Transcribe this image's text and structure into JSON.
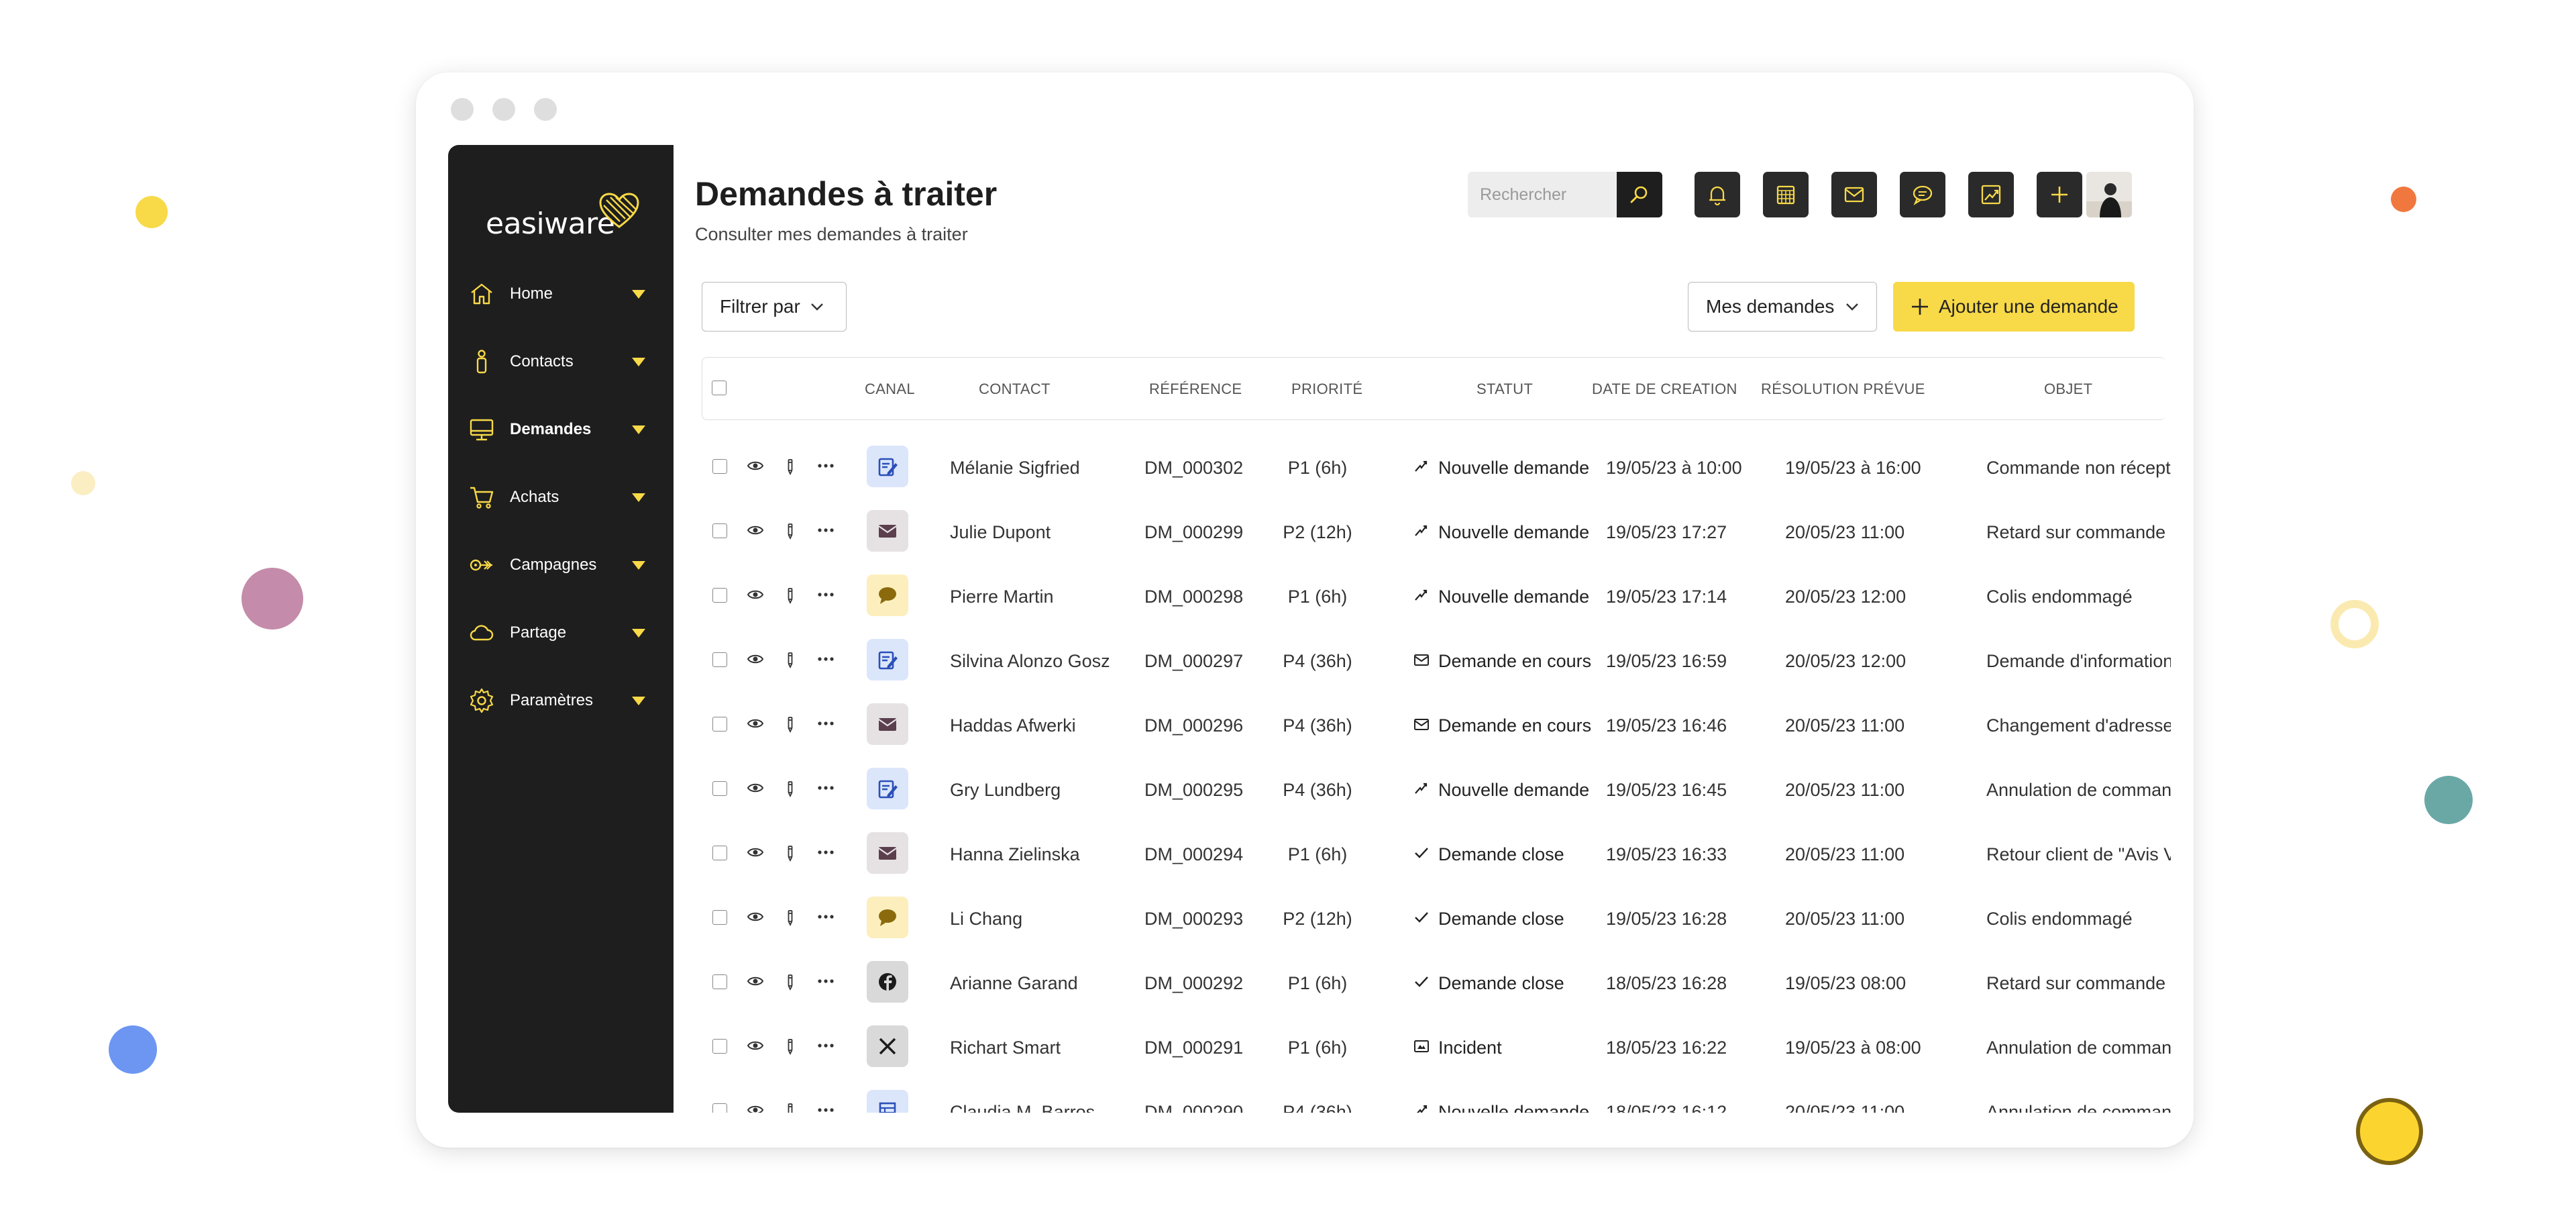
{
  "colors": {
    "accent": "#f8d947",
    "sidebar_bg": "#1e1e1e",
    "toolbar_btn": "#2a2a2a"
  },
  "logo": {
    "text": "easiware"
  },
  "sidebar": {
    "items": [
      {
        "label": "Home",
        "icon": "home-icon"
      },
      {
        "label": "Contacts",
        "icon": "contact-icon"
      },
      {
        "label": "Demandes",
        "icon": "monitor-icon",
        "active": true
      },
      {
        "label": "Achats",
        "icon": "cart-icon"
      },
      {
        "label": "Campagnes",
        "icon": "campaign-icon"
      },
      {
        "label": "Partage",
        "icon": "cloud-icon"
      },
      {
        "label": "Paramètres",
        "icon": "gear-icon"
      }
    ]
  },
  "header": {
    "title": "Demandes à traiter",
    "subtitle": "Consulter mes demandes à traiter",
    "search_placeholder": "Rechercher",
    "toolbar": [
      "bell-icon",
      "calendar-icon",
      "mail-icon",
      "chat-icon",
      "chart-icon",
      "plus-icon"
    ]
  },
  "actions": {
    "filter_label": "Filtrer par",
    "mine_label": "Mes demandes",
    "add_label": "Ajouter une demande"
  },
  "table": {
    "columns": [
      "CANAL",
      "CONTACT",
      "RÉFÉRENCE",
      "PRIORITÉ",
      "STATUT",
      "DATE DE CREATION",
      "RÉSOLUTION PRÉVUE",
      "OBJET"
    ],
    "rows": [
      {
        "channel": "form",
        "contact": "Mélanie Sigfried",
        "ref": "DM_000302",
        "priority": "P1 (6h)",
        "status_icon": "new",
        "status": "Nouvelle demande",
        "created": "19/05/23 à 10:00",
        "resolution": "19/05/23 à 16:00",
        "object": "Commande non réceptionnée"
      },
      {
        "channel": "mail",
        "contact": "Julie Dupont",
        "ref": "DM_000299",
        "priority": "P2 (12h)",
        "status_icon": "new",
        "status": "Nouvelle demande",
        "created": "19/05/23 17:27",
        "resolution": "20/05/23 11:00",
        "object": "Retard sur commande"
      },
      {
        "channel": "chat",
        "contact": "Pierre Martin",
        "ref": "DM_000298",
        "priority": "P1 (6h)",
        "status_icon": "new",
        "status": "Nouvelle demande",
        "created": "19/05/23 17:14",
        "resolution": "20/05/23 12:00",
        "object": "Colis endommagé"
      },
      {
        "channel": "form",
        "contact": "Silvina Alonzo Gosz",
        "ref": "DM_000297",
        "priority": "P4 (36h)",
        "status_icon": "progress",
        "status": "Demande en cours",
        "created": "19/05/23 16:59",
        "resolution": "20/05/23 12:00",
        "object": "Demande d'informations"
      },
      {
        "channel": "mail",
        "contact": "Haddas Afwerki",
        "ref": "DM_000296",
        "priority": "P4 (36h)",
        "status_icon": "progress",
        "status": "Demande en cours",
        "created": "19/05/23 16:46",
        "resolution": "20/05/23 11:00",
        "object": "Changement d'adresse"
      },
      {
        "channel": "form",
        "contact": "Gry Lundberg",
        "ref": "DM_000295",
        "priority": "P4 (36h)",
        "status_icon": "new",
        "status": "Nouvelle demande",
        "created": "19/05/23 16:45",
        "resolution": "20/05/23 11:00",
        "object": "Annulation de commande"
      },
      {
        "channel": "mail",
        "contact": "Hanna Zielinska",
        "ref": "DM_000294",
        "priority": "P1 (6h)",
        "status_icon": "closed",
        "status": "Demande close",
        "created": "19/05/23 16:33",
        "resolution": "20/05/23 11:00",
        "object": "Retour client de \"Avis Vérifiés\""
      },
      {
        "channel": "chat",
        "contact": "Li Chang",
        "ref": "DM_000293",
        "priority": "P2 (12h)",
        "status_icon": "closed",
        "status": "Demande close",
        "created": "19/05/23 16:28",
        "resolution": "20/05/23 11:00",
        "object": "Colis endommagé"
      },
      {
        "channel": "facebook",
        "contact": "Arianne Garand",
        "ref": "DM_000292",
        "priority": "P1 (6h)",
        "status_icon": "closed",
        "status": "Demande close",
        "created": "18/05/23 16:28",
        "resolution": "19/05/23 08:00",
        "object": "Retard sur commande"
      },
      {
        "channel": "x",
        "contact": "Richart Smart",
        "ref": "DM_000291",
        "priority": "P1 (6h)",
        "status_icon": "incident",
        "status": "Incident",
        "created": "18/05/23 16:22",
        "resolution": "19/05/23 à 08:00",
        "object": "Annulation de commande"
      },
      {
        "channel": "grid",
        "contact": "Claudia M. Barros",
        "ref": "DM_000290",
        "priority": "P4 (36h)",
        "status_icon": "new",
        "status": "Nouvelle demande",
        "created": "18/05/23 16:12",
        "resolution": "20/05/23 11:00",
        "object": "Annulation de commande"
      }
    ]
  }
}
